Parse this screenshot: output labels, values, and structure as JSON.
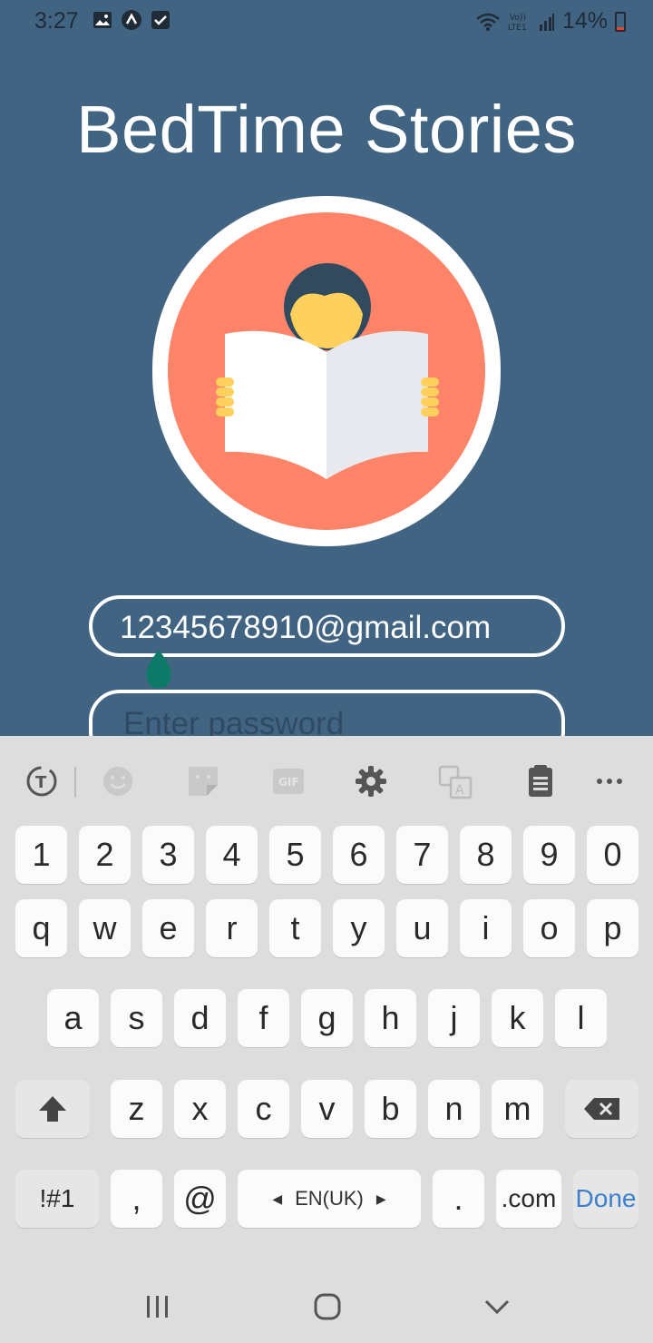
{
  "status_bar": {
    "time": "3:27",
    "left_icons": [
      "image-icon",
      "app-icon",
      "check-icon"
    ],
    "right_icons": [
      "wifi-icon",
      "volte-icon",
      "signal-icon"
    ],
    "battery": "14%",
    "battery_color": "#e8462e"
  },
  "app": {
    "title": "BedTime Stories",
    "background_color": "#416482",
    "logo": "reading-person-logo",
    "email_value": "12345678910@gmail.com",
    "password_placeholder": "Enter password"
  },
  "keyboard": {
    "toolbar": [
      "text-mode-icon",
      "emoji-icon",
      "sticker-icon",
      "gif-icon",
      "settings-icon",
      "translate-icon",
      "clipboard-icon",
      "more-icon"
    ],
    "rows": [
      [
        "1",
        "2",
        "3",
        "4",
        "5",
        "6",
        "7",
        "8",
        "9",
        "0"
      ],
      [
        "q",
        "w",
        "e",
        "r",
        "t",
        "y",
        "u",
        "i",
        "o",
        "p"
      ],
      [
        "a",
        "s",
        "d",
        "f",
        "g",
        "h",
        "j",
        "k",
        "l"
      ],
      [
        "z",
        "x",
        "c",
        "v",
        "b",
        "n",
        "m"
      ]
    ],
    "symbols_label": "!#1",
    "comma_label": ",",
    "at_label": "@",
    "space_label": "EN(UK)",
    "period_label": ".",
    "dotcom_label": ".com",
    "done_label": "Done",
    "done_color": "#3c7fcc"
  },
  "nav_bar": {
    "buttons": [
      "recents-icon",
      "home-icon",
      "back-icon"
    ]
  }
}
